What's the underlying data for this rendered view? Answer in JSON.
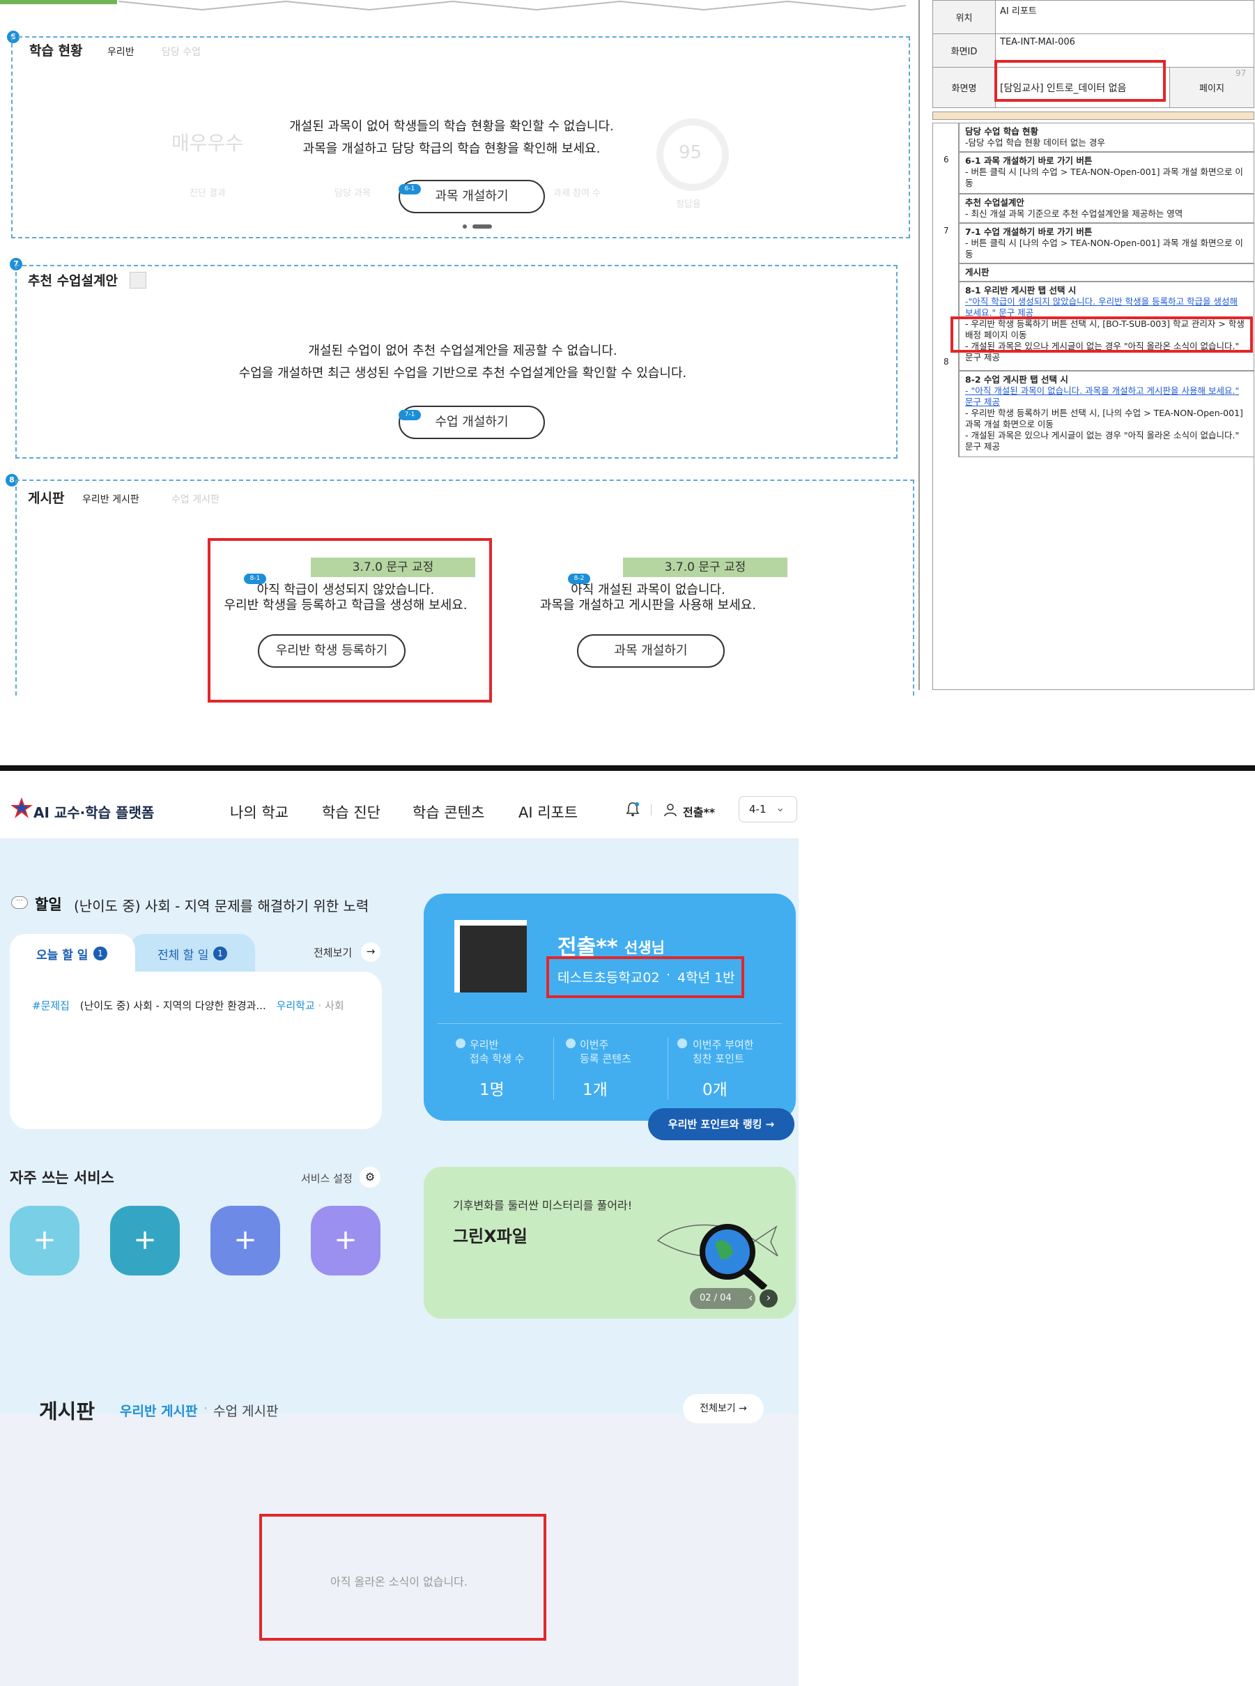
{
  "spec": {
    "location_label": "위치",
    "location_value": "AI 리포트",
    "screen_id_label": "화면ID",
    "screen_id_value": "TEA-INT-MAI-006",
    "screen_name_label": "화면명",
    "screen_name_value": "[담임교사] 인트로_데이터 없음",
    "page_label": "페이지",
    "page_number": "97",
    "rows": [
      {
        "num": "",
        "title": "담당 수업 학습 현황",
        "lines": [
          "-담당 수업 학습 현황 데이터 없는 경우"
        ]
      },
      {
        "num": "6",
        "title": "6-1 과목 개설하기 바로 가기 버튼",
        "lines": [
          "- 버튼 클릭 시 [나의 수업 > TEA-NON-Open-001] 과목 개설 화면으로 이동"
        ]
      },
      {
        "num": "",
        "title": "추천 수업설계안",
        "lines": [
          "- 최신 개설 과목 기준으로 추천 수업설계안을 제공하는 영역"
        ]
      },
      {
        "num": "7",
        "title": "7-1 수업 개설하기 바로 가기 버튼",
        "lines": [
          "- 버튼 클릭 시 [나의 수업 > TEA-NON-Open-001] 과목 개설 화면으로 이동"
        ]
      },
      {
        "num": "",
        "title": "게시판",
        "lines": []
      },
      {
        "num": "8",
        "title": "8-1 우리반 게시판 탭 선택 시",
        "lines": [
          "-\"아직 학급이 생성되지 않았습니다. 우리반 학생을 등록하고 학급을 생성해 보세요.\" 문구 제공",
          "- 우리반 학생 등록하기 버튼 선택 시, [BO-T-SUB-003] 학교 관리자 > 학생 배정 페이지 이동",
          "- 개설된 과목은 있으나 게시글이 없는 경우 \"아직 올라온 소식이 없습니다.\" 문구 제공"
        ]
      },
      {
        "num": "",
        "title": "8-2 수업 게시판 탭 선택 시",
        "lines": [
          "- \"아직 개설된 과목이 없습니다. 과목을 개설하고 게시판을 사용해 보세요.\" 문구 제공",
          "- 우리반 학생 등록하기 버튼 선택 시, [나의 수업 > TEA-NON-Open-001] 과목 개설 화면으로 이동",
          "- 개설된 과목은 있으나 게시글이 없는 경우 \"아직 올라온 소식이 없습니다.\" 문구 제공"
        ]
      }
    ]
  },
  "wire": {
    "sec6": {
      "marker": "6",
      "title": "학습 현황",
      "tab_active": "우리반",
      "tab_inactive": "담당 수업",
      "msg1": "개설된 과목이 없어 학생들의 학습 현황을 확인할 수 없습니다.",
      "msg2": "과목을 개설하고 담당 학급의 학습 현황을 확인해 보세요.",
      "tag": "6-1",
      "button": "과목 개설하기",
      "ghost_grade": "매우우수",
      "ghost_score": "95",
      "ghost_a": "진단 결과",
      "ghost_b": "담당 과목",
      "ghost_c": "과제 참여 수",
      "ghost_d": "정답율"
    },
    "sec7": {
      "marker": "7",
      "title": "추천 수업설계안",
      "msg1": "개설된 수업이 없어 추천 수업설계안을 제공할 수 없습니다.",
      "msg2": "수업을 개설하면 최근 생성된 수업을 기반으로 추천 수업설계안을 확인할 수 있습니다.",
      "tag": "7-1",
      "button": "수업 개설하기"
    },
    "sec8": {
      "marker": "8",
      "title": "게시판",
      "tab_active": "우리반 게시판",
      "tab_inactive": "수업 게시판",
      "left": {
        "badge": "3.7.0 문구 교정",
        "tag": "8-1",
        "msg1": "아직 학급이 생성되지 않았습니다.",
        "msg2": "우리반 학생을 등록하고 학급을 생성해 보세요.",
        "button": "우리반 학생 등록하기"
      },
      "right": {
        "badge": "3.7.0 문구 교정",
        "tag": "8-2",
        "msg1": "아직 개설된 과목이 없습니다.",
        "msg2": "과목을 개설하고 게시판을 사용해 보세요.",
        "button": "과목 개설하기"
      }
    }
  },
  "app": {
    "brand": "AI 교수·학습 플랫폼",
    "nav": [
      "나의 학교",
      "학습 진단",
      "학습 콘텐츠",
      "AI 리포트"
    ],
    "user": "전출**",
    "class_select": "4-1",
    "todo": {
      "heading_icon": "speech-bubble-icon",
      "heading": "할일",
      "heading_detail": "(난이도 중) 사회 - 지역 문제를 해결하기 위한 노력",
      "tab_today": "오늘 할 일",
      "tab_today_count": "1",
      "tab_all": "전체 할 일",
      "tab_all_count": "1",
      "view_all": "전체보기",
      "item_tag": "#문제집",
      "item_text": "(난이도 중) 사회 - 지역의 다양한 환경과...",
      "item_scope": "우리학교",
      "item_subject": "사회"
    },
    "profile": {
      "name": "전출**",
      "suffix": "선생님",
      "school": "테스트초등학교02",
      "grade": "4학년 1반",
      "stats": [
        {
          "label1": "우리반",
          "label2": "접속 학생 수",
          "value": "1명"
        },
        {
          "label1": "이번주",
          "label2": "등록 콘텐츠",
          "value": "1개"
        },
        {
          "label1": "이번주 부여한",
          "label2": "칭찬 포인트",
          "value": "0개"
        }
      ],
      "ranking_button": "우리반 포인트와 랭킹 →"
    },
    "services": {
      "title": "자주 쓰는 서비스",
      "settings": "서비스 설정",
      "colors": [
        "#79cfe6",
        "#34a6c4",
        "#6d8ae6",
        "#9b8ff0"
      ]
    },
    "banner": {
      "subtitle": "기후변화를 둘러싼 미스터리를 풀어라!",
      "title": "그린X파일",
      "pager": "02 / 04"
    },
    "board": {
      "title": "게시판",
      "tab_active": "우리반 게시판",
      "tab_inactive": "수업 게시판",
      "view_all": "전체보기 →",
      "empty": "아직 올라온 소식이 없습니다."
    }
  }
}
